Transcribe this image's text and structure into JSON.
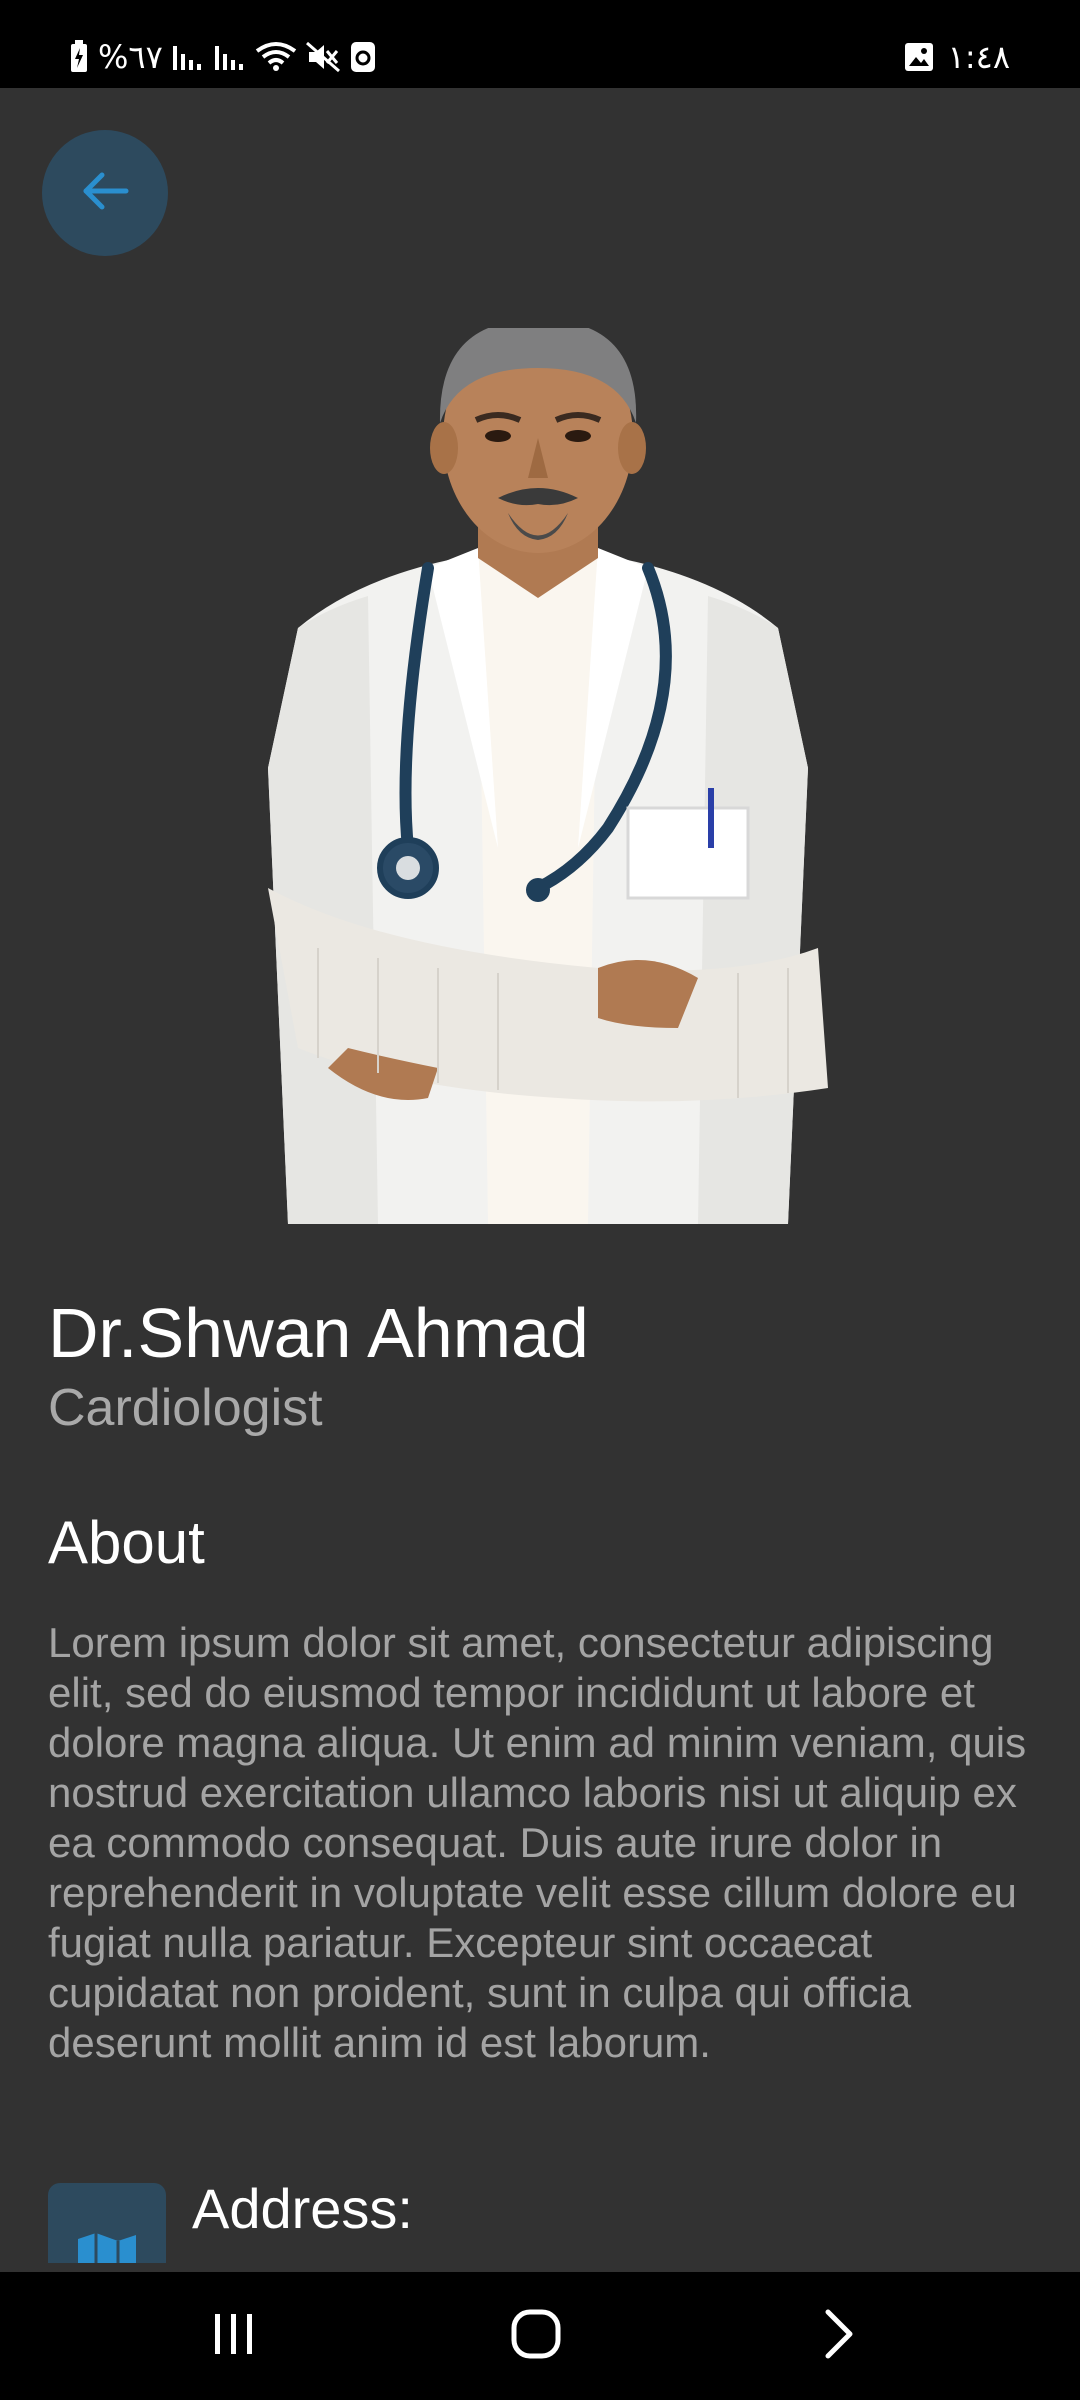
{
  "status_bar": {
    "battery_text": "%٦٧",
    "time": "١:٤٨"
  },
  "icons": {
    "back": "arrow-left-icon",
    "address": "map-icon",
    "nav_recents": "recents-icon",
    "nav_home": "home-icon",
    "nav_back": "chevron-right-icon"
  },
  "colors": {
    "background": "#323232",
    "accent": "#2a8fcf",
    "accent_bg": "#2d4a5e",
    "secondary_text": "#a4a4a4"
  },
  "doctor": {
    "name": "Dr.Shwan Ahmad",
    "specialty": "Cardiologist"
  },
  "about": {
    "heading": "About",
    "text": "Lorem ipsum dolor sit amet, consectetur adipiscing elit, sed do eiusmod tempor incididunt ut labore et dolore magna aliqua. Ut enim ad minim veniam, quis nostrud exercitation ullamco laboris nisi ut aliquip ex ea commodo consequat. Duis aute irure dolor in reprehenderit in voluptate velit esse cillum dolore eu fugiat nulla pariatur. Excepteur sint occaecat cupidatat non proident, sunt in culpa qui officia deserunt mollit anim id est laborum."
  },
  "address": {
    "label": "Address:"
  }
}
